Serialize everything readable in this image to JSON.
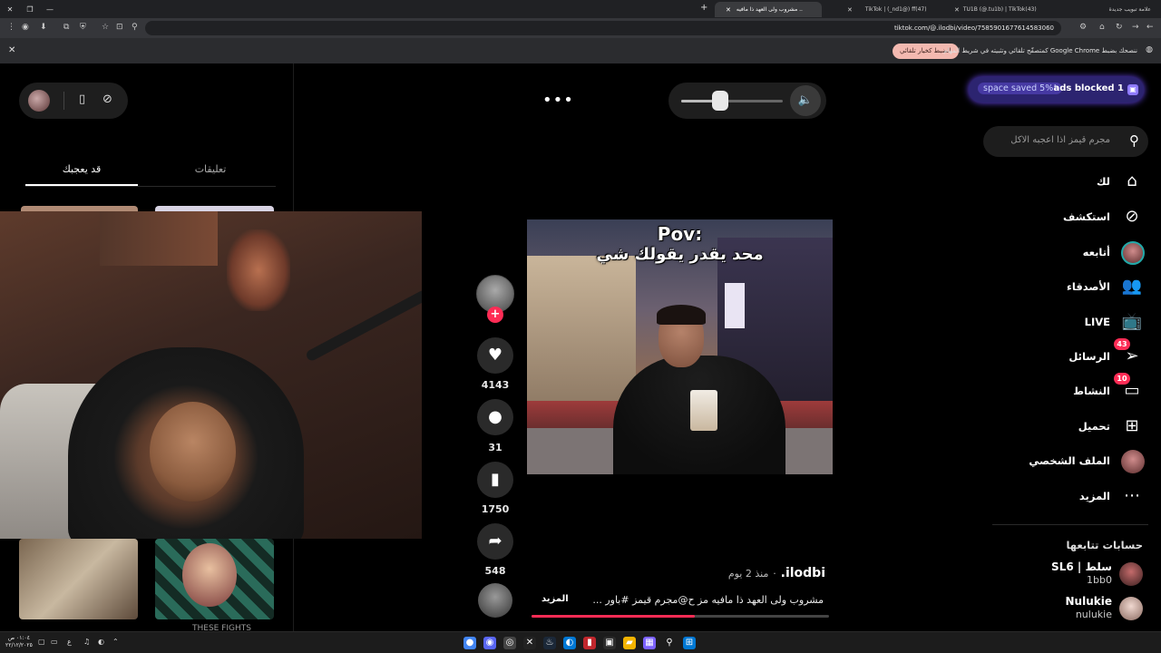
{
  "browser": {
    "tabs": [
      {
        "title": "علامة تبويب جديدة",
        "active": false
      },
      {
        "title": "TU1B (@.tu1b) | TikTok(43)",
        "active": false
      },
      {
        "title": "TikTok | (_nd1@) ff(47)",
        "active": false
      },
      {
        "title": "مشروب ولى العهد ذا مافيه ..",
        "active": true
      }
    ],
    "url": "tiktok.com/@.ilodbi/video/7585901677614583060",
    "infobar_message": "ننصحك بضبط Google Chrome كمتصفّح تلقائي وتثبيته في شريط المهام",
    "infobar_button": "الضبط كخيار تلقائي"
  },
  "left_panel": {
    "tab_you_may_like": "قد يعجبك",
    "tab_comments": "تعليقات",
    "bottom_caption_right": "THESE FIGHTS"
  },
  "player": {
    "volume_fraction": 0.38,
    "more_dots": "•••",
    "caption_line1": "Pov:",
    "caption_line2": "محد يقدر يقولك شي",
    "likes": "4143",
    "comments": "31",
    "saves": "1750",
    "shares": "548",
    "author": "ilodbi.",
    "posted": "منذ 2 يوم",
    "separator": "·",
    "description": "مشروب ولى العهد ذا مافيه مز ح@مجرم قيمز #باور ...",
    "more_label": "المزيد",
    "progress_fraction": 0.55
  },
  "ads_badge": {
    "saved": "space saved 5%!",
    "blocked": "ads blocked 1"
  },
  "search": {
    "placeholder": "مجرم قيمز اذا اعجبه الاكل"
  },
  "nav": {
    "for_you": "لك",
    "explore": "استكشف",
    "following": "أتابعه",
    "friends": "الأصدقاء",
    "live": "LIVE",
    "messages": "الرسائل",
    "messages_badge": "43",
    "activity": "النشاط",
    "activity_badge": "10",
    "upload": "تحميل",
    "profile": "الملف الشخصي",
    "more": "المزيد"
  },
  "following_accounts": {
    "title": "حسابات تتابعها",
    "accounts": [
      {
        "name": "SL6 | سلط",
        "handle": "1bb0"
      },
      {
        "name": "Nulukie",
        "handle": "nulukie"
      }
    ]
  },
  "taskbar": {
    "clock_time": "٠١:٠٤ ص",
    "clock_date": "٢٢/١٢/٢٠٢٥",
    "lang": "ع"
  }
}
